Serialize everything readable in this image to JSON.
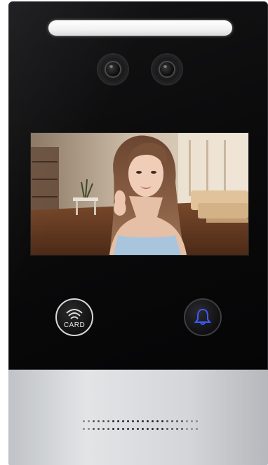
{
  "device": {
    "card_button": {
      "label": "CARD",
      "icon": "rfid-card-icon"
    },
    "call_button": {
      "icon": "bell-icon",
      "accent_color": "#3a5cff"
    },
    "screen": {
      "content": "video-feed"
    },
    "cameras": [
      "camera-lens-icon",
      "camera-lens-icon"
    ],
    "colors": {
      "glass": "#0b0b0c",
      "panel_metal": "#d3d5d8",
      "ir_light": "#f1f1f1"
    }
  }
}
